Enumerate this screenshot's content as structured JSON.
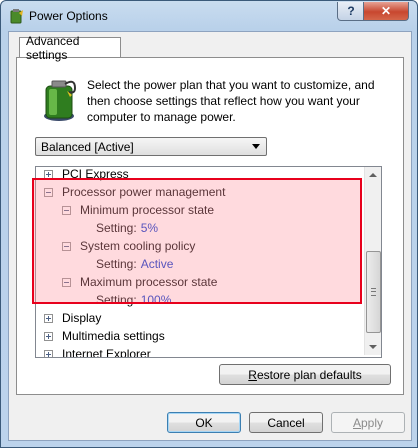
{
  "window": {
    "title": "Power Options",
    "help_glyph": "?",
    "close_glyph": "✕"
  },
  "tab": {
    "label": "Advanced settings"
  },
  "description": "Select the power plan that you want to customize, and then choose settings that reflect how you want your computer to manage power.",
  "plan_select": {
    "value": "Balanced [Active]"
  },
  "tree": {
    "items": [
      {
        "label": "PCI Express",
        "expander": "+"
      },
      {
        "label": "Processor power management",
        "expander": "-"
      },
      {
        "label": "Minimum processor state",
        "expander": "-"
      },
      {
        "setting_label": "Setting:",
        "value": "5%"
      },
      {
        "label": "System cooling policy",
        "expander": "-"
      },
      {
        "setting_label": "Setting:",
        "value": "Active"
      },
      {
        "label": "Maximum processor state",
        "expander": "-"
      },
      {
        "setting_label": "Setting:",
        "value": "100%"
      },
      {
        "label": "Display",
        "expander": "+"
      },
      {
        "label": "Multimedia settings",
        "expander": "+"
      },
      {
        "label": "Internet Explorer",
        "expander": "+"
      }
    ]
  },
  "buttons": {
    "restore_first": "R",
    "restore_rest": "estore plan defaults",
    "ok": "OK",
    "cancel": "Cancel",
    "apply_first": "A",
    "apply_rest": "pply"
  },
  "colors": {
    "highlight_border": "#e8001c",
    "setting_value": "#0033cc"
  }
}
